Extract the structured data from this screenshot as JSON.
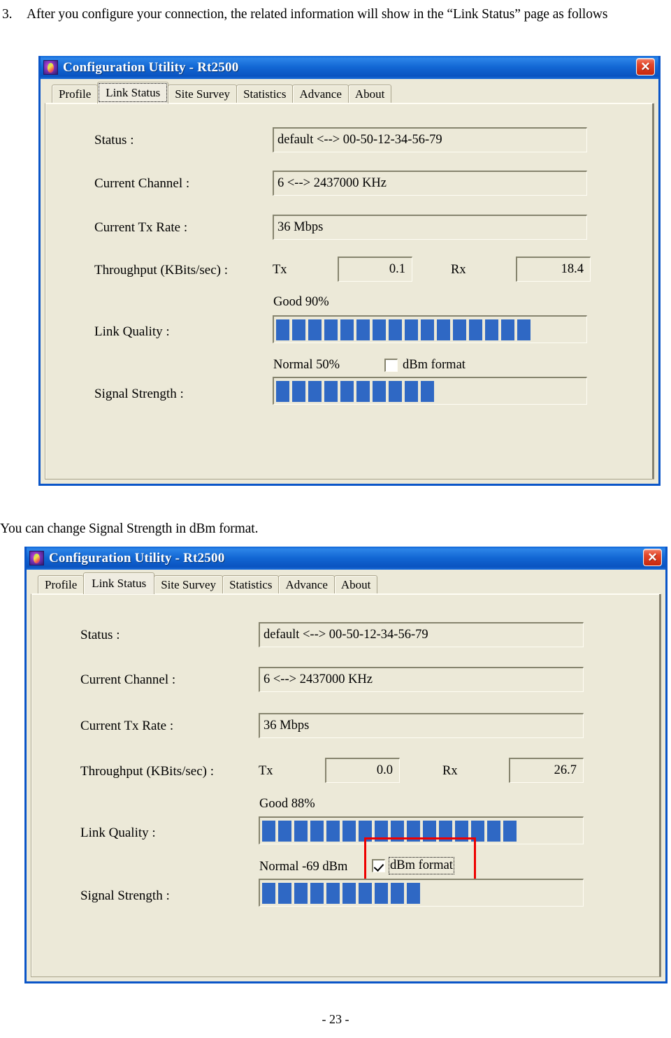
{
  "document": {
    "step_number": "3.",
    "step_text": "After you configure your connection, the related information will show in the “Link Status” page as follows",
    "middle_text": "You can change Signal Strength in dBm format.",
    "page_number": "- 23 -"
  },
  "colors": {
    "titlebar_blue": "#1267d4",
    "window_border_blue": "#0a55c8",
    "client_face": "#ece9d8",
    "meter_bar_blue": "#2f68c4",
    "close_button_red": "#c6270c",
    "highlight_red": "#ee0000"
  },
  "window1": {
    "title": "Configuration Utility - Rt2500",
    "icon": "app-icon",
    "close_label": "✕",
    "tabs": [
      {
        "label": "Profile",
        "active": false
      },
      {
        "label": "Link Status",
        "active": true
      },
      {
        "label": "Site Survey",
        "active": false
      },
      {
        "label": "Statistics",
        "active": false
      },
      {
        "label": "Advance",
        "active": false
      },
      {
        "label": "About",
        "active": false
      }
    ],
    "fields": {
      "status_label": "Status :",
      "status_value": "default <--> 00-50-12-34-56-79",
      "channel_label": "Current Channel :",
      "channel_value": "6 <--> 2437000 KHz",
      "txrate_label": "Current Tx Rate :",
      "txrate_value": "36 Mbps",
      "throughput_label": "Throughput (KBits/sec) :",
      "tx_label": "Tx",
      "tx_value": "0.1",
      "rx_label": "Rx",
      "rx_value": "18.4",
      "link_quality_label": "Link Quality :",
      "link_quality_caption": "Good 90%",
      "link_quality_percent": 90,
      "link_quality_segments": 16,
      "signal_label": "Signal Strength :",
      "signal_caption": "Normal 50%",
      "signal_percent": 50,
      "signal_segments": 10,
      "dbm_checkbox_label": "dBm format",
      "dbm_checked": false
    }
  },
  "window2": {
    "title": "Configuration Utility - Rt2500",
    "icon": "app-icon",
    "close_label": "✕",
    "tabs": [
      {
        "label": "Profile",
        "active": false
      },
      {
        "label": "Link Status",
        "active": true
      },
      {
        "label": "Site Survey",
        "active": false
      },
      {
        "label": "Statistics",
        "active": false
      },
      {
        "label": "Advance",
        "active": false
      },
      {
        "label": "About",
        "active": false
      }
    ],
    "fields": {
      "status_label": "Status :",
      "status_value": "default <--> 00-50-12-34-56-79",
      "channel_label": "Current Channel :",
      "channel_value": "6 <--> 2437000 KHz",
      "txrate_label": "Current Tx Rate :",
      "txrate_value": "36 Mbps",
      "throughput_label": "Throughput (KBits/sec) :",
      "tx_label": "Tx",
      "tx_value": "0.0",
      "rx_label": "Rx",
      "rx_value": "26.7",
      "link_quality_label": "Link Quality :",
      "link_quality_caption": "Good 88%",
      "link_quality_percent": 88,
      "link_quality_segments": 16,
      "signal_label": "Signal Strength :",
      "signal_caption": "Normal -69 dBm",
      "signal_segments": 10,
      "dbm_checkbox_label": "dBm format",
      "dbm_checked": true
    }
  }
}
